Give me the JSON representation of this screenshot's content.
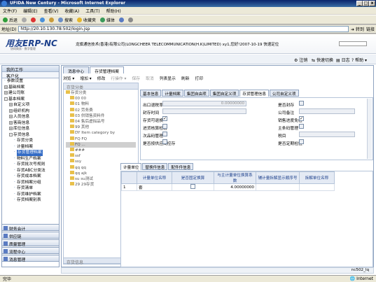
{
  "window": {
    "title": "UFIDA New Century - Microsoft Internet Explorer"
  },
  "menubar": {
    "items": [
      "文件(F)",
      "编辑(E)",
      "查看(V)",
      "收藏(A)",
      "工具(T)",
      "帮助(H)"
    ]
  },
  "toolbar": {
    "back": "后退",
    "search": "搜索",
    "favorites": "收藏夹",
    "media": "媒体"
  },
  "address": {
    "label": "地址(D)",
    "url": "http://20.10.130.78:502/login.jsp",
    "go": "转到",
    "links": "链接"
  },
  "header": {
    "logo": "用友ERP-NC",
    "logo_sub": "协同商务 · 数字管理",
    "company": "龙旗通信技术(香港)有限公司(LONGCHEER TELECOMMUNICATION(H.K)LIMITED) xy1,您好!2007-10-19  快速定位"
  },
  "subbar": {
    "logout": "注销",
    "quickswitch": "快速切换",
    "log": "日志",
    "help": "帮助"
  },
  "leftnav": {
    "title": "我的工作",
    "section": "客户化",
    "items": [
      {
        "label": "参数设置",
        "pm": "",
        "indent": 1
      },
      {
        "label": "基础档案",
        "pm": "+",
        "indent": 1
      },
      {
        "label": "建公司账",
        "pm": "+",
        "indent": 1
      },
      {
        "label": "基本档案",
        "pm": "-",
        "indent": 1
      },
      {
        "label": "自定义项",
        "pm": "+",
        "indent": 2
      },
      {
        "label": "组织机构",
        "pm": "+",
        "indent": 2
      },
      {
        "label": "人员信息",
        "pm": "+",
        "indent": 2
      },
      {
        "label": "客商信息",
        "pm": "+",
        "indent": 2
      },
      {
        "label": "库位信息",
        "pm": "+",
        "indent": 2
      },
      {
        "label": "存货信息",
        "pm": "-",
        "indent": 2
      },
      {
        "label": "存货分类",
        "pm": "",
        "indent": 3
      },
      {
        "label": "计量档案",
        "pm": "",
        "indent": 3
      },
      {
        "label": "存货管理档案",
        "pm": "",
        "indent": 3,
        "selected": true
      },
      {
        "label": "物料生产档案",
        "pm": "",
        "indent": 3
      },
      {
        "label": "存货批次号规则",
        "pm": "",
        "indent": 3
      },
      {
        "label": "存货ABC分类法",
        "pm": "",
        "indent": 3
      },
      {
        "label": "存货成本档案",
        "pm": "",
        "indent": 3
      },
      {
        "label": "存货档案分组",
        "pm": "",
        "indent": 3
      },
      {
        "label": "存货清单",
        "pm": "",
        "indent": 3
      },
      {
        "label": "存货维护档案",
        "pm": "",
        "indent": 3
      },
      {
        "label": "存货档案别表",
        "pm": "",
        "indent": 3
      }
    ],
    "bottom": [
      "财务会计",
      "供应链",
      "质量管理",
      "流程中心",
      "消息管理"
    ]
  },
  "maintabs": [
    "消息中心",
    "存货管理档案"
  ],
  "actions": [
    {
      "label": "浏览 ▾",
      "disabled": false
    },
    {
      "label": "增加 ▾",
      "disabled": false
    },
    {
      "label": "修改",
      "disabled": false
    },
    {
      "label": "行操作 ▾",
      "disabled": true
    },
    {
      "label": "保存",
      "disabled": true
    },
    {
      "label": "取消",
      "disabled": true
    },
    {
      "label": "列表显示",
      "disabled": false
    },
    {
      "label": "刷新",
      "disabled": false
    },
    {
      "label": "打印",
      "disabled": false
    }
  ],
  "catetree": {
    "header": "存货分类",
    "items": [
      "存货分类",
      "00 00",
      "01 物料",
      "02 劳务费",
      "03 供销售资料件",
      "04 售后虚拟品号",
      "99 其他",
      "DY Item category by",
      "FQ FQ",
      "FQ ...",
      "###",
      "ssf",
      "ssy",
      "qq qq",
      "qq ajk",
      "su su测试",
      "29 29存货"
    ],
    "footer": "存货信息"
  },
  "formtabs": [
    "基本信息",
    "计量档案",
    "集团自由项",
    "集团自定义项",
    "存货管理信息",
    "公司自定义项"
  ],
  "form": {
    "fields_left": [
      {
        "label": "出口退税率",
        "value": "0.00000000",
        "type": "input"
      },
      {
        "label": "封存时间",
        "value": "",
        "type": "input"
      },
      {
        "label": "存货可退换",
        "value": "✓",
        "type": "check"
      },
      {
        "label": "进货核算检验",
        "value": "",
        "type": "check"
      },
      {
        "label": "次品码管理",
        "value": "",
        "type": "check"
      },
      {
        "label": "是否按供应商控存",
        "value": "",
        "type": "check"
      }
    ],
    "fields_right": [
      {
        "label": "是否封存",
        "value": "",
        "type": "check"
      },
      {
        "label": "公司备注",
        "value": "",
        "type": "input"
      },
      {
        "label": "销售进度免检",
        "value": "✓",
        "type": "check"
      },
      {
        "label": "主条码管理",
        "value": "",
        "type": "check"
      },
      {
        "label": "税目",
        "value": "",
        "type": "input"
      },
      {
        "label": "是否定期检验",
        "value": "",
        "type": "check"
      }
    ]
  },
  "gridtabs": [
    "计量单位",
    "替换件信息",
    "配件件信息"
  ],
  "grid": {
    "columns": [
      "",
      "计量单位名称",
      "是否固定换算",
      "与主计量单位换算系数",
      "辅计量拆解显示顺序号",
      "拆解单位名称"
    ],
    "rows": [
      [
        "1",
        "套",
        "",
        "4.00000000",
        "",
        ""
      ]
    ]
  },
  "appstatus": "nc502_lq",
  "status": {
    "text": "完毕",
    "zone": "Internet"
  }
}
